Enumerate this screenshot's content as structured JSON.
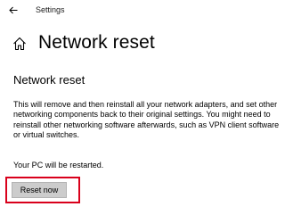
{
  "titlebar": {
    "app_name": "Settings",
    "back_icon": "back-arrow-icon"
  },
  "header": {
    "home_icon": "home-icon",
    "title": "Network reset"
  },
  "content": {
    "section_title": "Network reset",
    "description": "This will remove and then reinstall all your network adapters, and set other networking components back to their original settings. You might need to reinstall other networking software afterwards, such as VPN client software or virtual switches.",
    "restart_note": "Your PC will be restarted.",
    "reset_button_label": "Reset now"
  },
  "colors": {
    "highlight_border": "#d9001b",
    "button_background": "#cccccc"
  }
}
